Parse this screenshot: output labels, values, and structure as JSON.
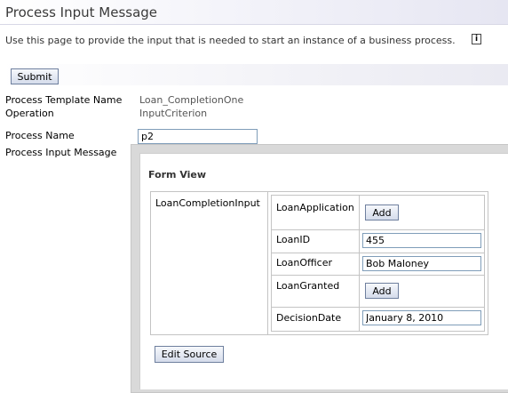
{
  "header": {
    "title": "Process Input Message"
  },
  "description": "Use this page to provide the input that is needed to start an instance of a business process.",
  "info_icon": {
    "glyph": "i",
    "icon": "info-icon"
  },
  "toolbar": {
    "submit_label": "Submit"
  },
  "details": {
    "template_label": "Process Template Name",
    "template_value": "Loan_CompletionOne",
    "operation_label": "Operation",
    "operation_value": "InputCriterion",
    "process_name_label": "Process Name",
    "process_name_value": "p2",
    "input_message_label": "Process Input Message"
  },
  "form_view": {
    "title": "Form View",
    "root_label": "LoanCompletionInput",
    "fields": [
      {
        "name": "LoanApplication",
        "kind": "button",
        "button_label": "Add"
      },
      {
        "name": "LoanID",
        "kind": "text",
        "value": "455"
      },
      {
        "name": "LoanOfficer",
        "kind": "text",
        "value": "Bob Maloney"
      },
      {
        "name": "LoanGranted",
        "kind": "button",
        "button_label": "Add"
      },
      {
        "name": "DecisionDate",
        "kind": "text",
        "value": "January 8, 2010"
      }
    ],
    "edit_source_label": "Edit Source"
  },
  "colors": {
    "accent_border": "#7f9db9",
    "button_border": "#6e7f9e",
    "panel_gray": "#d9d9d9"
  }
}
